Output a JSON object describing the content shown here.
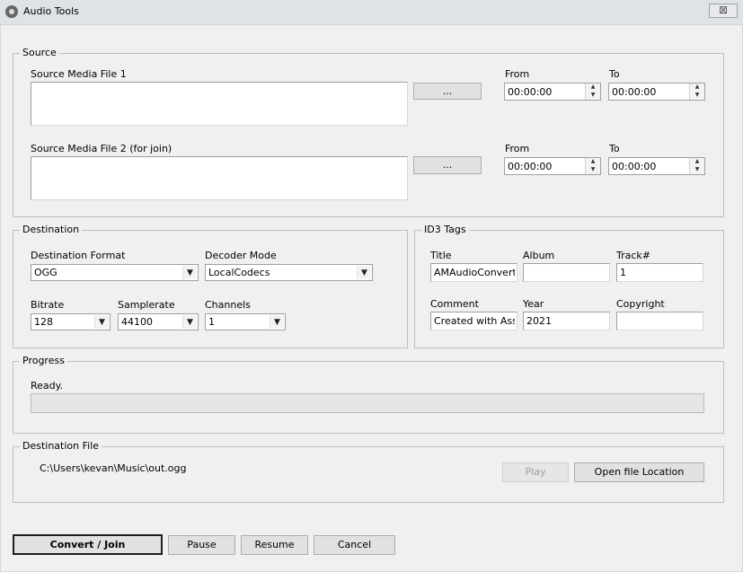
{
  "window": {
    "title": "Audio Tools",
    "close_glyph": "⊠"
  },
  "source": {
    "group_title": "Source",
    "file1": {
      "label": "Source Media File 1",
      "value": "",
      "browse": "...",
      "from_label": "From",
      "from_value": "00:00:00",
      "to_label": "To",
      "to_value": "00:00:00"
    },
    "file2": {
      "label": "Source Media File 2 (for join)",
      "value": "",
      "browse": "...",
      "from_label": "From",
      "from_value": "00:00:00",
      "to_label": "To",
      "to_value": "00:00:00"
    }
  },
  "destination": {
    "group_title": "Destination",
    "format_label": "Destination Format",
    "format_value": "OGG",
    "decoder_label": "Decoder Mode",
    "decoder_value": "LocalCodecs",
    "bitrate_label": "Bitrate",
    "bitrate_value": "128",
    "samplerate_label": "Samplerate",
    "samplerate_value": "44100",
    "channels_label": "Channels",
    "channels_value": "1"
  },
  "id3": {
    "group_title": "ID3 Tags",
    "title_label": "Title",
    "title_value": "AMAudioConverte",
    "album_label": "Album",
    "album_value": "",
    "track_label": "Track#",
    "track_value": "1",
    "comment_label": "Comment",
    "comment_value": "Created with Asse",
    "year_label": "Year",
    "year_value": "2021",
    "copyright_label": "Copyright",
    "copyright_value": ""
  },
  "progress": {
    "group_title": "Progress",
    "status": "Ready.",
    "percent": 0
  },
  "dest_file": {
    "group_title": "Destination File",
    "path": "C:\\Users\\kevan\\Music\\out.ogg",
    "play": "Play",
    "open_location": "Open file Location"
  },
  "actions": {
    "convert": "Convert / Join",
    "pause": "Pause",
    "resume": "Resume",
    "cancel": "Cancel"
  },
  "icons": {
    "spin_up": "▲",
    "spin_down": "▼",
    "combo_arrow": "▼"
  },
  "colors": {
    "window_bg": "#f0f0f0",
    "titlebar_bg": "#dfe3e8",
    "group_border": "#bfbfbf"
  }
}
